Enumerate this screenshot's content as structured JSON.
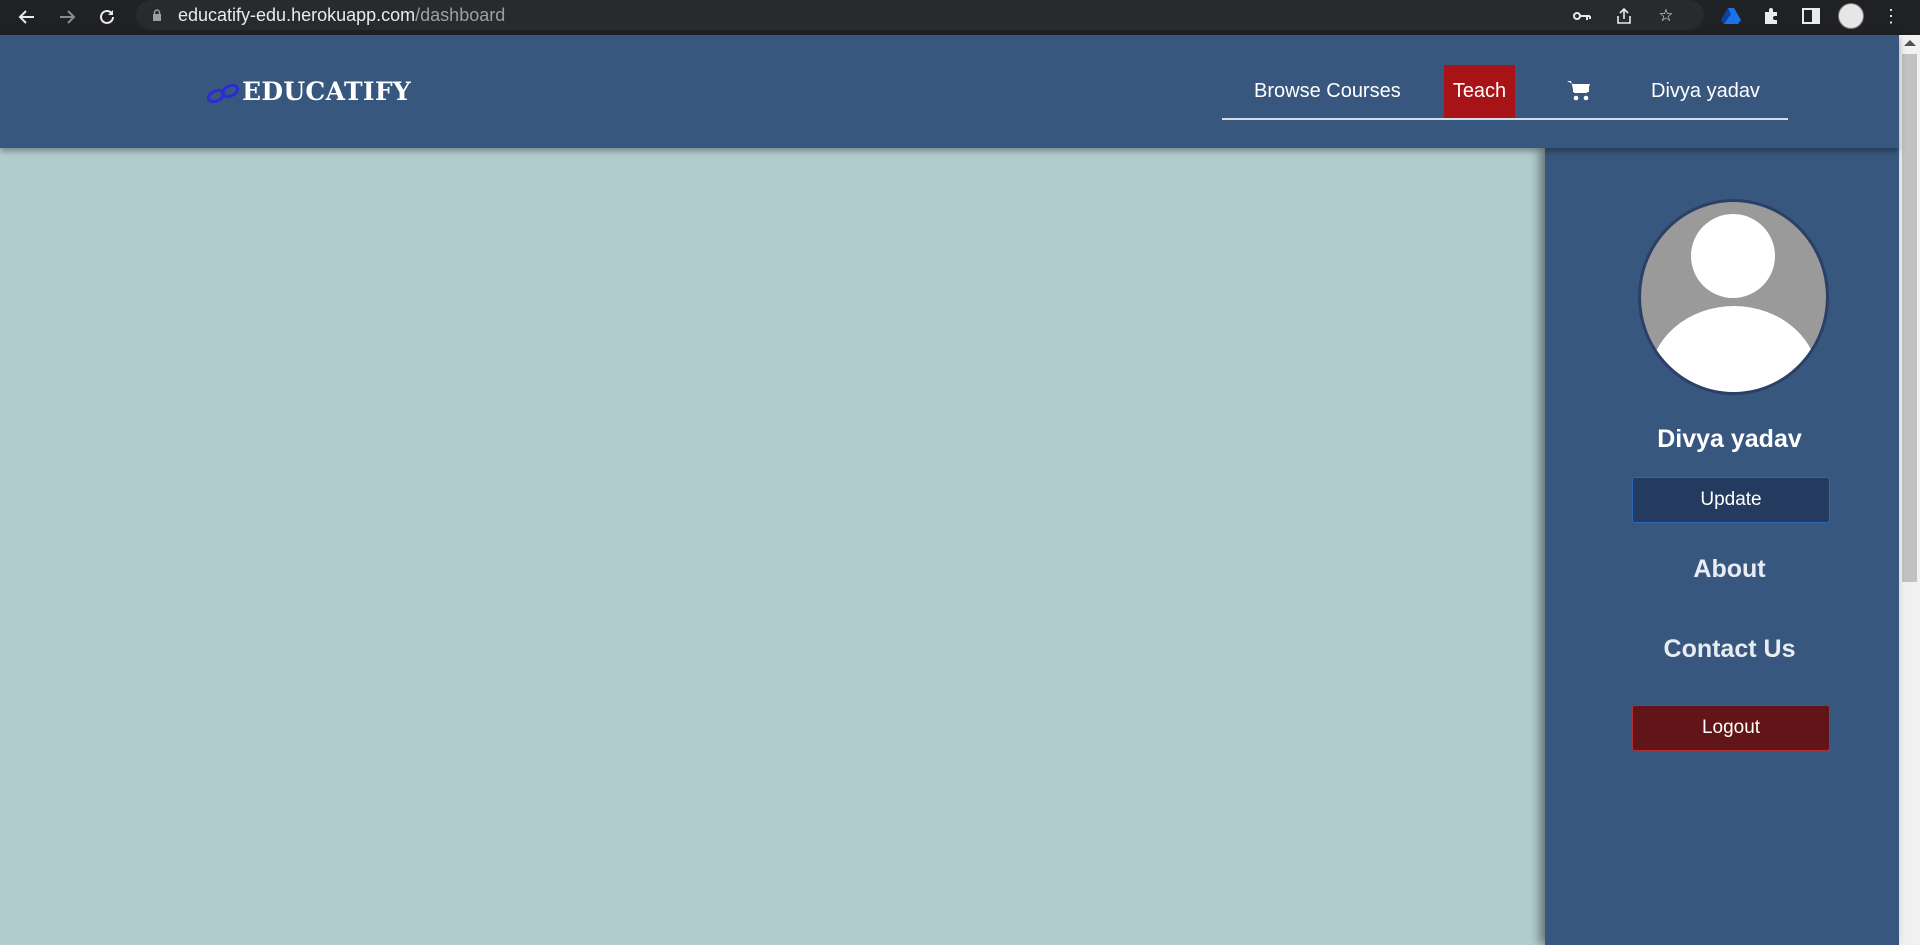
{
  "browser": {
    "url_host": "educatify-edu.herokuapp.com",
    "url_path": "/dashboard"
  },
  "header": {
    "brand": "EDUCATIFY",
    "nav": {
      "browse": "Browse Courses",
      "teach": "Teach",
      "user": "Divya yadav"
    },
    "colors": {
      "bar": "#38577f",
      "teach": "#a81317"
    }
  },
  "sidebar": {
    "name": "Divya yadav",
    "update_label": "Update",
    "about_label": "About",
    "contact_label": "Contact Us",
    "logout_label": "Logout"
  },
  "main": {
    "background": "#b2cdcf"
  },
  "icons": [
    "back-icon",
    "forward-icon",
    "reload-icon",
    "lock-icon",
    "key-icon",
    "share-icon",
    "star-icon",
    "drive-icon",
    "puzzle-icon",
    "sidepanel-icon",
    "profile-avatar",
    "menu-icon",
    "cart-icon",
    "avatar-placeholder"
  ]
}
